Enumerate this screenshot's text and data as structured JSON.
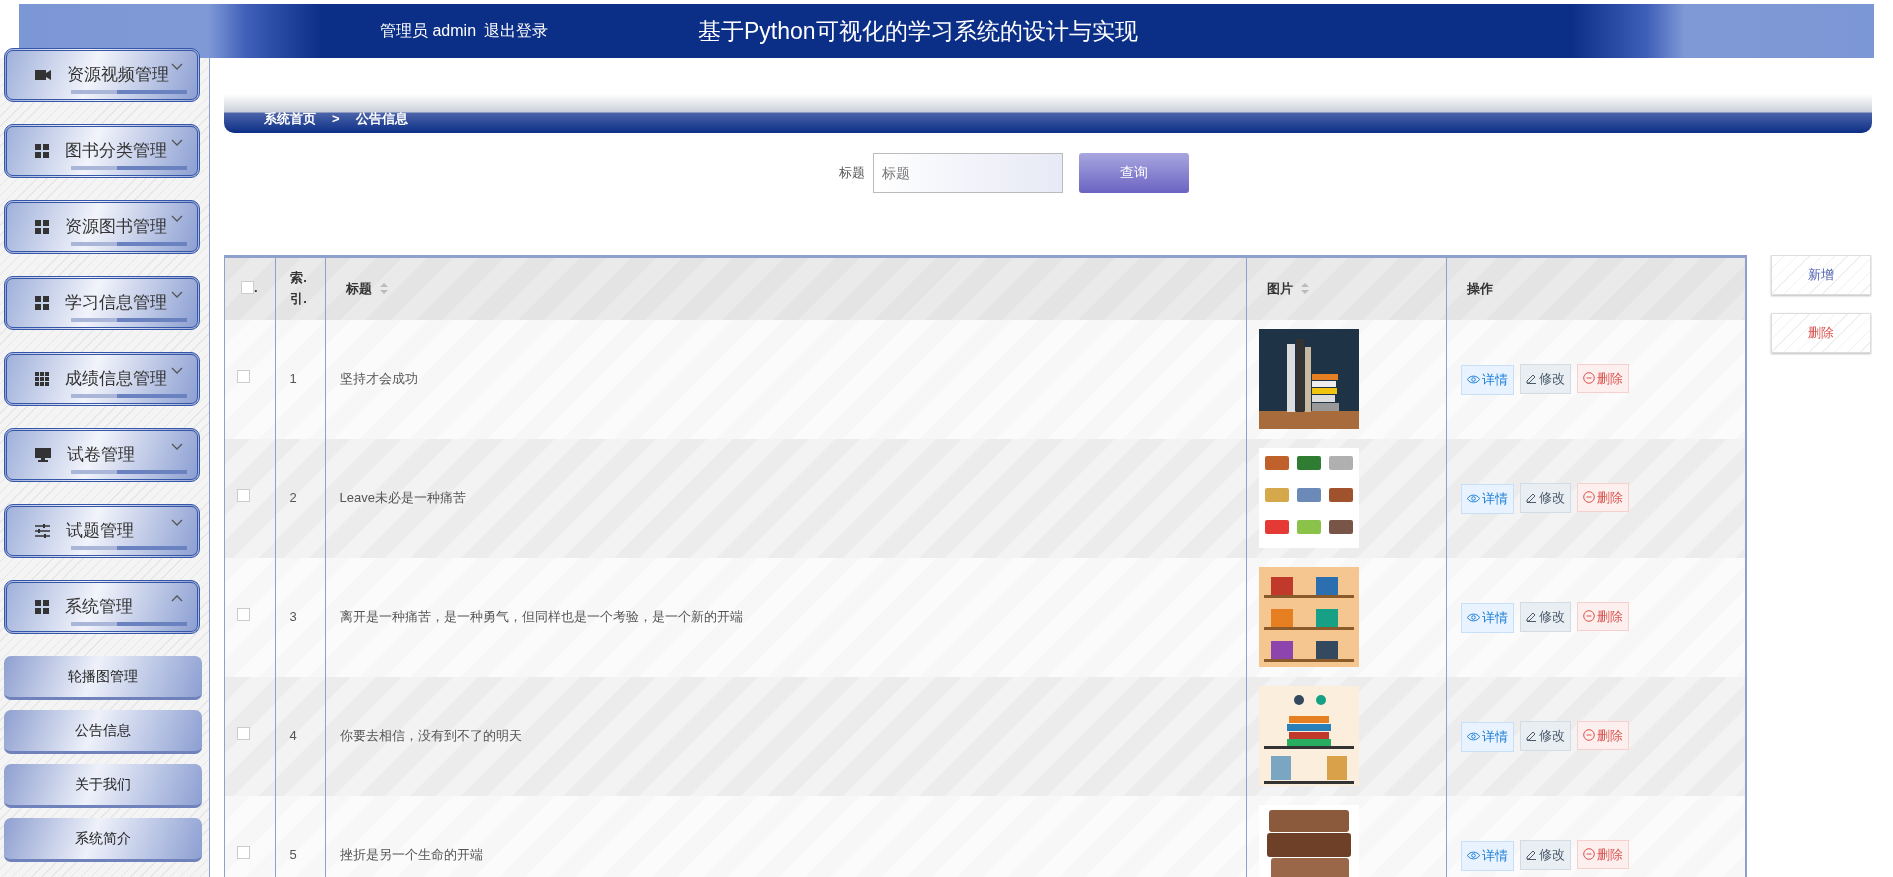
{
  "header": {
    "user_label": "管理员 admin",
    "logout": "退出登录",
    "title": "基于Python可视化的学习系统的设计与实现"
  },
  "sidebar": {
    "items": [
      {
        "label": "资源视频管理",
        "kind": "video",
        "expanded": false
      },
      {
        "label": "图书分类管理",
        "kind": "grid4",
        "expanded": false
      },
      {
        "label": "资源图书管理",
        "kind": "grid4",
        "expanded": false
      },
      {
        "label": "学习信息管理",
        "kind": "grid4",
        "expanded": false
      },
      {
        "label": "成绩信息管理",
        "kind": "grid9",
        "expanded": false
      },
      {
        "label": "试卷管理",
        "kind": "monitor",
        "expanded": false
      },
      {
        "label": "试题管理",
        "kind": "sliders",
        "expanded": false
      },
      {
        "label": "系统管理",
        "kind": "grid4",
        "expanded": true,
        "children": [
          {
            "label": "轮播图管理"
          },
          {
            "label": "公告信息"
          },
          {
            "label": "关于我们"
          },
          {
            "label": "系统简介"
          }
        ]
      }
    ]
  },
  "breadcrumb": {
    "home": "系统首页",
    "separator": ">",
    "current": "公告信息"
  },
  "search": {
    "label": "标题",
    "placeholder": "标题",
    "button": "查询"
  },
  "side_buttons": [
    {
      "kind": "add",
      "label": "新增"
    },
    {
      "kind": "delete",
      "label": "删除"
    }
  ],
  "table": {
    "select_all": {
      "checked": false,
      "label": "."
    },
    "columns": [
      {
        "label": "索.引.",
        "sortable": false
      },
      {
        "label": "标题",
        "sortable": true
      },
      {
        "label": "图片",
        "sortable": true
      },
      {
        "label": "操作",
        "sortable": false
      }
    ],
    "rows": [
      {
        "checked": false,
        "index": "1",
        "title": "坚持才会成功",
        "picture": {
          "kind": "picture"
        },
        "actions": [
          {
            "kind": "view",
            "label": "详情"
          },
          {
            "kind": "edit",
            "label": "修改"
          },
          {
            "kind": "delete",
            "label": "删除"
          }
        ]
      },
      {
        "checked": false,
        "index": "2",
        "title": "Leave未必是一种痛苦",
        "picture": {
          "kind": "picture"
        },
        "actions": [
          {
            "kind": "view",
            "label": "详情"
          },
          {
            "kind": "edit",
            "label": "修改"
          },
          {
            "kind": "delete",
            "label": "删除"
          }
        ]
      },
      {
        "checked": false,
        "index": "3",
        "title": "离开是一种痛苦，是一种勇气，但同样也是一个考验，是一个新的开端",
        "picture": {
          "kind": "picture"
        },
        "actions": [
          {
            "kind": "view",
            "label": "详情"
          },
          {
            "kind": "edit",
            "label": "修改"
          },
          {
            "kind": "delete",
            "label": "删除"
          }
        ]
      },
      {
        "checked": false,
        "index": "4",
        "title": "你要去相信，没有到不了的明天",
        "picture": {
          "kind": "picture"
        },
        "actions": [
          {
            "kind": "view",
            "label": "详情"
          },
          {
            "kind": "edit",
            "label": "修改"
          },
          {
            "kind": "delete",
            "label": "删除"
          }
        ]
      },
      {
        "checked": false,
        "index": "5",
        "title": "挫折是另一个生命的开端",
        "picture": {
          "kind": "picture"
        },
        "actions": [
          {
            "kind": "view",
            "label": "详情"
          },
          {
            "kind": "edit",
            "label": "修改"
          },
          {
            "kind": "delete",
            "label": "删除"
          }
        ]
      }
    ]
  }
}
